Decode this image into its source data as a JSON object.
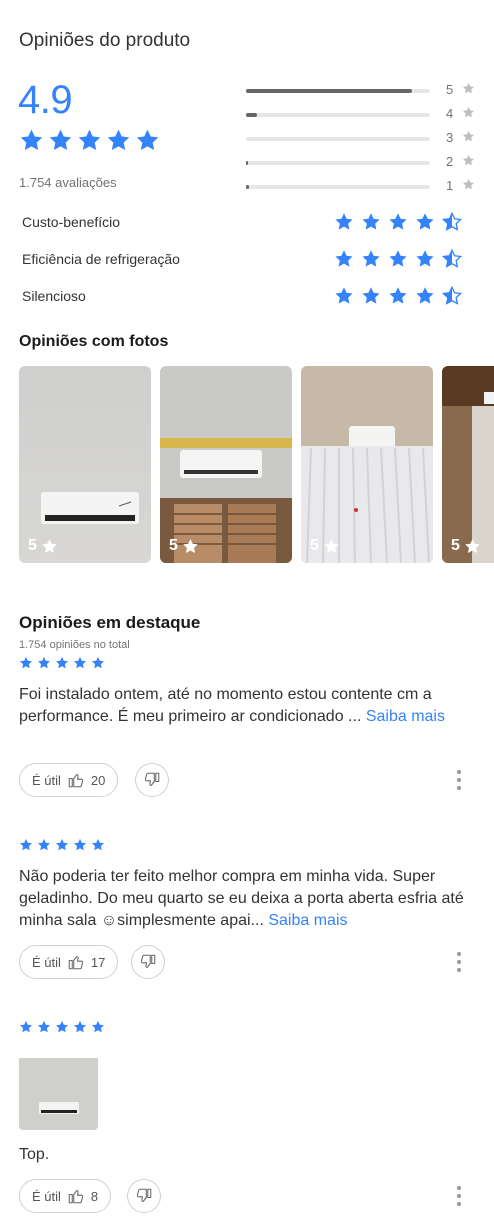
{
  "title": "Opiniões do produto",
  "average": "4.9",
  "rating_count": "1.754 avaliações",
  "distribution": [
    {
      "label": "5",
      "fraction": 0.9
    },
    {
      "label": "4",
      "fraction": 0.06
    },
    {
      "label": "3",
      "fraction": 0.0
    },
    {
      "label": "2",
      "fraction": 0.005
    },
    {
      "label": "1",
      "fraction": 0.015
    }
  ],
  "attributes": [
    {
      "name": "Custo-benefício",
      "rating": 4.5
    },
    {
      "name": "Eficiência de refrigeração",
      "rating": 4.5
    },
    {
      "name": "Silencioso",
      "rating": 4.5
    }
  ],
  "photos_section": {
    "title": "Opiniões com fotos",
    "photos": [
      {
        "rating": "5"
      },
      {
        "rating": "5"
      },
      {
        "rating": "5"
      },
      {
        "rating": "5"
      }
    ]
  },
  "featured": {
    "title": "Opiniões em destaque",
    "subtitle": "1.754 opiniões no total"
  },
  "reviews": [
    {
      "text": "Foi instalado ontem, até no momento estou contente cm a performance. É meu primeiro ar condicionado ... ",
      "more": "Saiba mais",
      "useful_label": "É útil",
      "useful_count": "20"
    },
    {
      "text": "Não poderia ter feito melhor compra em minha vida. Super geladinho. Do meu quarto se eu deixa a porta aberta esfria até minha sala ☺simplesmente apai... ",
      "more": "Saiba mais",
      "useful_label": "É útil",
      "useful_count": "17"
    },
    {
      "text": "Top.",
      "more": "",
      "useful_label": "É útil",
      "useful_count": "8"
    }
  ],
  "colors": {
    "accent": "#3483fa",
    "bar": "#666666",
    "muted_star": "#bfbfbf"
  }
}
